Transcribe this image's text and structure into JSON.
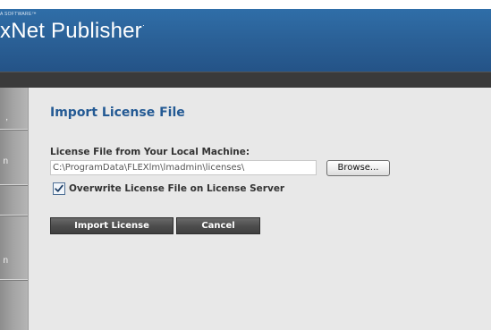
{
  "header": {
    "tagline": "A SOFTWARE™",
    "app_title": "xNet Publisher",
    "title_mark": "·"
  },
  "sidebar": {
    "items": [
      {
        "label": ","
      },
      {
        "label": "n"
      },
      {
        "label": "n"
      }
    ]
  },
  "dialog": {
    "title": "Import License File",
    "field_label": "License File from Your Local Machine:",
    "path_value": "C:\\ProgramData\\FLEXlm\\lmadmin\\licenses\\",
    "browse_label": "Browse...",
    "overwrite_checked": true,
    "overwrite_label": "Overwrite License File on License Server",
    "import_label": "Import License",
    "cancel_label": "Cancel"
  },
  "colors": {
    "header_blue": "#2a5f95",
    "title_blue": "#245a94",
    "panel_bg": "#e8e8e8",
    "button_dark": "#4e4e4e"
  }
}
